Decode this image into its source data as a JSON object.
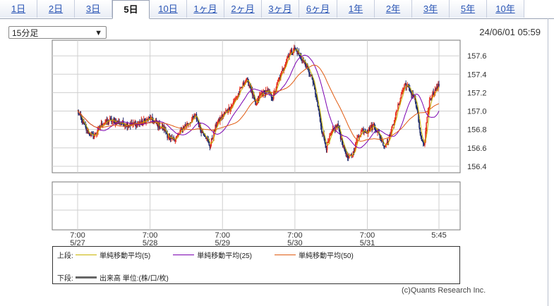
{
  "tabs": [
    {
      "label": "1日",
      "active": false
    },
    {
      "label": "2日",
      "active": false
    },
    {
      "label": "3日",
      "active": false
    },
    {
      "label": "5日",
      "active": true
    },
    {
      "label": "10日",
      "active": false
    },
    {
      "label": "1ヶ月",
      "active": false
    },
    {
      "label": "2ヶ月",
      "active": false
    },
    {
      "label": "3ヶ月",
      "active": false
    },
    {
      "label": "6ヶ月",
      "active": false
    },
    {
      "label": "1年",
      "active": false
    },
    {
      "label": "2年",
      "active": false
    },
    {
      "label": "3年",
      "active": false
    },
    {
      "label": "5年",
      "active": false
    },
    {
      "label": "10年",
      "active": false
    }
  ],
  "interval_select": {
    "value": "15分足"
  },
  "timestamp": "24/06/01 05:59",
  "legend": {
    "upper_label": "上段:",
    "lower_label": "下段:",
    "ma5": "単純移動平均(5)",
    "ma25": "単純移動平均(25)",
    "ma50": "単純移動平均(50)",
    "volume": "出来高 単位:(株/口/枚)"
  },
  "copyright": "(c)Quants Research Inc.",
  "colors": {
    "up": "#e53020",
    "down": "#1f2a6b",
    "ma5": "#c8b400",
    "ma25": "#7a00b0",
    "ma50": "#e05a10",
    "grid": "#cfcfcf",
    "volume": "#666666"
  },
  "chart_data": {
    "type": "line",
    "ylim": [
      156.33,
      157.77
    ],
    "yticks": [
      "157.6",
      "157.4",
      "157.2",
      "157.0",
      "156.8",
      "156.6",
      "156.4"
    ],
    "ytick_values": [
      157.6,
      157.4,
      157.2,
      157.0,
      156.8,
      156.6,
      156.4
    ],
    "xticks": [
      {
        "time": "7:00",
        "date": "5/27",
        "i": 0
      },
      {
        "time": "7:00",
        "date": "5/28",
        "i": 92
      },
      {
        "time": "7:00",
        "date": "5/29",
        "i": 184
      },
      {
        "time": "7:00",
        "date": "5/30",
        "i": 276
      },
      {
        "time": "7:00",
        "date": "5/31",
        "i": 368
      },
      {
        "time": "5:45",
        "date": "",
        "i": 459
      }
    ],
    "x_count": 460,
    "price_anchors": [
      [
        0,
        157.0
      ],
      [
        5,
        156.9
      ],
      [
        12,
        156.78
      ],
      [
        20,
        156.72
      ],
      [
        30,
        156.85
      ],
      [
        40,
        156.9
      ],
      [
        50,
        156.88
      ],
      [
        60,
        156.86
      ],
      [
        70,
        156.85
      ],
      [
        80,
        156.87
      ],
      [
        92,
        156.92
      ],
      [
        100,
        156.86
      ],
      [
        110,
        156.8
      ],
      [
        118,
        156.68
      ],
      [
        126,
        156.72
      ],
      [
        134,
        156.82
      ],
      [
        142,
        156.88
      ],
      [
        150,
        156.95
      ],
      [
        156,
        156.8
      ],
      [
        162,
        156.74
      ],
      [
        168,
        156.62
      ],
      [
        176,
        156.85
      ],
      [
        184,
        156.95
      ],
      [
        195,
        157.05
      ],
      [
        205,
        157.2
      ],
      [
        214,
        157.35
      ],
      [
        220,
        157.25
      ],
      [
        226,
        157.05
      ],
      [
        232,
        157.18
      ],
      [
        240,
        157.22
      ],
      [
        248,
        157.15
      ],
      [
        256,
        157.35
      ],
      [
        262,
        157.48
      ],
      [
        268,
        157.62
      ],
      [
        276,
        157.68
      ],
      [
        282,
        157.6
      ],
      [
        290,
        157.5
      ],
      [
        298,
        157.35
      ],
      [
        304,
        157.1
      ],
      [
        310,
        156.8
      ],
      [
        316,
        156.6
      ],
      [
        322,
        156.75
      ],
      [
        330,
        156.85
      ],
      [
        338,
        156.6
      ],
      [
        344,
        156.48
      ],
      [
        350,
        156.55
      ],
      [
        356,
        156.72
      ],
      [
        362,
        156.8
      ],
      [
        368,
        156.78
      ],
      [
        376,
        156.85
      ],
      [
        384,
        156.72
      ],
      [
        390,
        156.62
      ],
      [
        396,
        156.72
      ],
      [
        404,
        156.95
      ],
      [
        410,
        157.15
      ],
      [
        416,
        157.3
      ],
      [
        422,
        157.22
      ],
      [
        428,
        157.15
      ],
      [
        432,
        156.95
      ],
      [
        436,
        156.7
      ],
      [
        440,
        156.6
      ],
      [
        444,
        156.95
      ],
      [
        448,
        157.15
      ],
      [
        454,
        157.22
      ],
      [
        459,
        157.28
      ]
    ],
    "series": [
      {
        "name": "単純移動平均(5)",
        "window": 5
      },
      {
        "name": "単純移動平均(25)",
        "window": 25
      },
      {
        "name": "単純移動平均(50)",
        "window": 50
      }
    ]
  }
}
